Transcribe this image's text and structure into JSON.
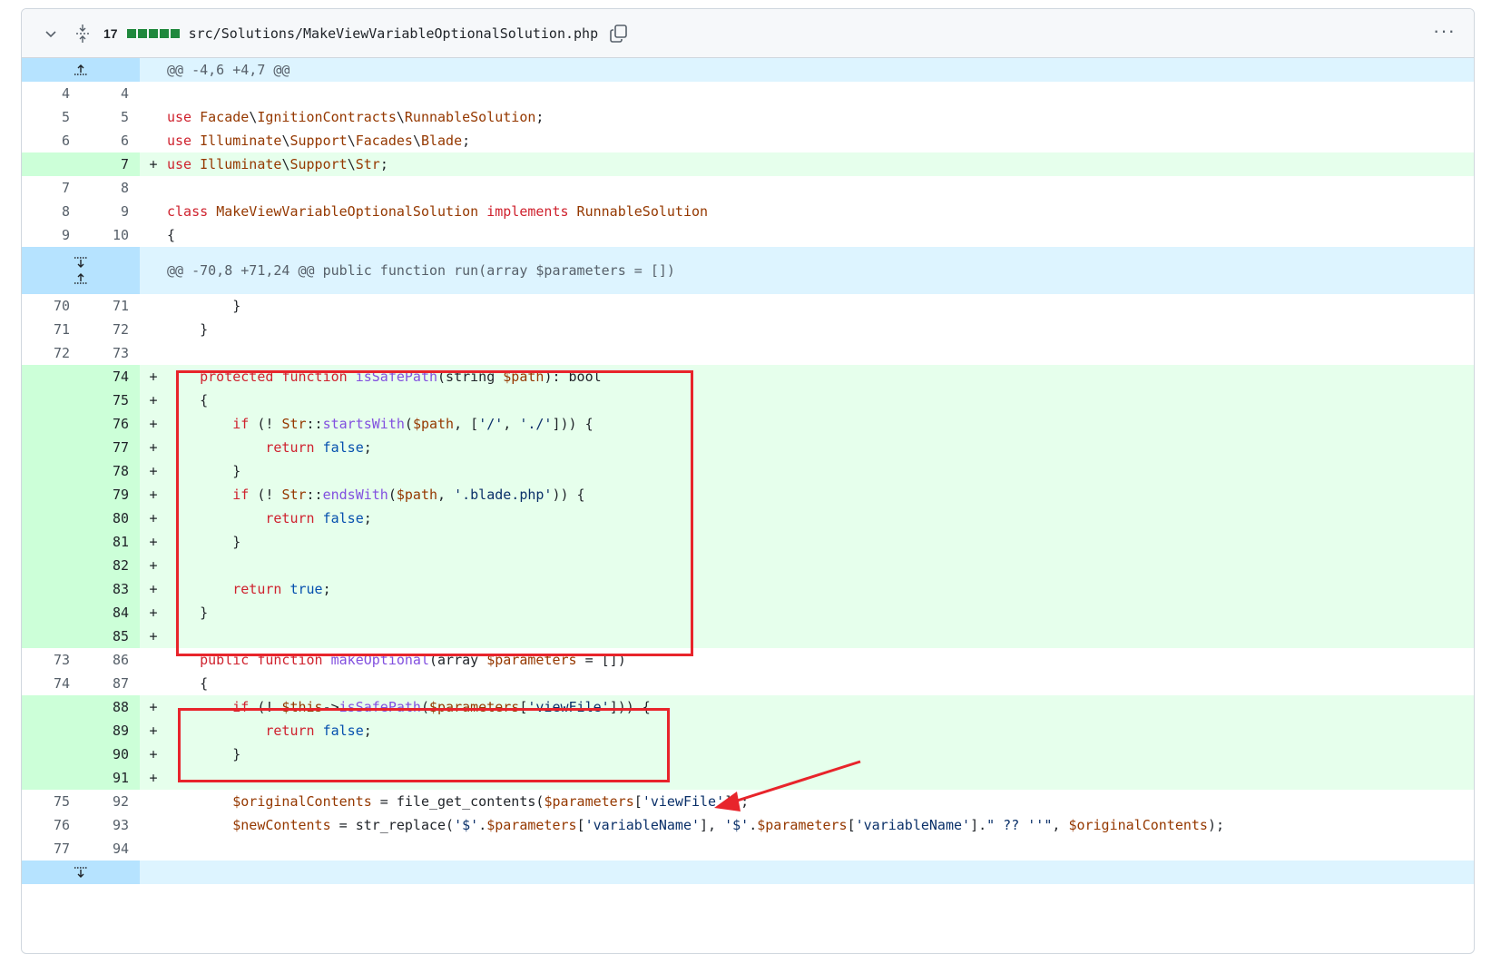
{
  "file": {
    "changes_count": "17",
    "path": "src/Solutions/MakeViewVariableOptionalSolution.php",
    "diffstat_blocks": 5,
    "menu_label": "···"
  },
  "hunks": [
    "@@ -4,6 +4,7 @@",
    "@@ -70,8 +71,24 @@ public function run(array $parameters = [])"
  ],
  "colors": {
    "keyword": "#cf222e",
    "type": "#953800",
    "function": "#8250df",
    "string": "#0a3069",
    "constant": "#0550ae",
    "added_bg": "#e6ffec",
    "hunk_bg": "#ddf4ff",
    "annotation": "#e8242b"
  },
  "rows": [
    {
      "type": "hunk",
      "text": "@@ -4,6 +4,7 @@",
      "expand": "up"
    },
    {
      "type": "ctx",
      "old": "4",
      "new": "4",
      "html": ""
    },
    {
      "type": "ctx",
      "old": "5",
      "new": "5",
      "html": "<span class='k'>use</span> <span class='t'>Facade</span>\\<span class='t'>IgnitionContracts</span>\\<span class='t'>RunnableSolution</span>;"
    },
    {
      "type": "ctx",
      "old": "6",
      "new": "6",
      "html": "<span class='k'>use</span> <span class='t'>Illuminate</span>\\<span class='t'>Support</span>\\<span class='t'>Facades</span>\\<span class='t'>Blade</span>;"
    },
    {
      "type": "add",
      "old": "",
      "new": "7",
      "html": "<span class='k'>use</span> <span class='t'>Illuminate</span>\\<span class='t'>Support</span>\\<span class='t'>Str</span>;"
    },
    {
      "type": "ctx",
      "old": "7",
      "new": "8",
      "html": ""
    },
    {
      "type": "ctx",
      "old": "8",
      "new": "9",
      "html": "<span class='k'>class</span> <span class='t'>MakeViewVariableOptionalSolution</span> <span class='k'>implements</span> <span class='t'>RunnableSolution</span>"
    },
    {
      "type": "ctx",
      "old": "9",
      "new": "10",
      "html": "{"
    },
    {
      "type": "hunk",
      "text": "@@ -70,8 +71,24 @@ public function run(array $parameters = [])",
      "expand": "both"
    },
    {
      "type": "ctx",
      "old": "70",
      "new": "71",
      "html": "        }"
    },
    {
      "type": "ctx",
      "old": "71",
      "new": "72",
      "html": "    }"
    },
    {
      "type": "ctx",
      "old": "72",
      "new": "73",
      "html": ""
    },
    {
      "type": "add",
      "old": "",
      "new": "74",
      "html": "    <span class='k'>protected</span> <span class='k'>function</span> <span class='f'>isSafePath</span>(string <span class='t'>$path</span>): bool"
    },
    {
      "type": "add",
      "old": "",
      "new": "75",
      "html": "    {"
    },
    {
      "type": "add",
      "old": "",
      "new": "76",
      "html": "        <span class='k'>if</span> (! <span class='t'>Str</span>::<span class='f'>startsWith</span>(<span class='t'>$path</span>, [<span class='s'>'/'</span>, <span class='s'>'./'</span>])) {"
    },
    {
      "type": "add",
      "old": "",
      "new": "77",
      "html": "            <span class='k'>return</span> <span class='b'>false</span>;"
    },
    {
      "type": "add",
      "old": "",
      "new": "78",
      "html": "        }"
    },
    {
      "type": "add",
      "old": "",
      "new": "79",
      "html": "        <span class='k'>if</span> (! <span class='t'>Str</span>::<span class='f'>endsWith</span>(<span class='t'>$path</span>, <span class='s'>'.blade.php'</span>)) {"
    },
    {
      "type": "add",
      "old": "",
      "new": "80",
      "html": "            <span class='k'>return</span> <span class='b'>false</span>;"
    },
    {
      "type": "add",
      "old": "",
      "new": "81",
      "html": "        }"
    },
    {
      "type": "add",
      "old": "",
      "new": "82",
      "html": ""
    },
    {
      "type": "add",
      "old": "",
      "new": "83",
      "html": "        <span class='k'>return</span> <span class='b'>true</span>;"
    },
    {
      "type": "add",
      "old": "",
      "new": "84",
      "html": "    }"
    },
    {
      "type": "add",
      "old": "",
      "new": "85",
      "html": ""
    },
    {
      "type": "ctx",
      "old": "73",
      "new": "86",
      "html": "    <span class='k'>public</span> <span class='k'>function</span> <span class='f'>makeOptional</span>(array <span class='t'>$parameters</span> = [])"
    },
    {
      "type": "ctx",
      "old": "74",
      "new": "87",
      "html": "    {"
    },
    {
      "type": "add",
      "old": "",
      "new": "88",
      "html": "        <span class='k'>if</span> (! <span class='t'>$this</span>-&gt;<span class='f'>isSafePath</span>(<span class='t'>$parameters</span>[<span class='s'>'viewFile'</span>])) {"
    },
    {
      "type": "add",
      "old": "",
      "new": "89",
      "html": "            <span class='k'>return</span> <span class='b'>false</span>;"
    },
    {
      "type": "add",
      "old": "",
      "new": "90",
      "html": "        }"
    },
    {
      "type": "add",
      "old": "",
      "new": "91",
      "html": ""
    },
    {
      "type": "ctx",
      "old": "75",
      "new": "92",
      "html": "        <span class='t'>$originalContents</span> = file_get_contents(<span class='t'>$parameters</span>[<span class='s'>'viewFile'</span>]);"
    },
    {
      "type": "ctx",
      "old": "76",
      "new": "93",
      "html": "        <span class='t'>$newContents</span> = str_replace(<span class='s'>'$'</span>.<span class='t'>$parameters</span>[<span class='s'>'variableName'</span>], <span class='s'>'$'</span>.<span class='t'>$parameters</span>[<span class='s'>'variableName'</span>].<span class='s'>\" ?? ''\"</span>, <span class='t'>$originalContents</span>);"
    },
    {
      "type": "ctx",
      "old": "77",
      "new": "94",
      "html": ""
    },
    {
      "type": "hunk",
      "text": "",
      "expand": "down"
    }
  ]
}
